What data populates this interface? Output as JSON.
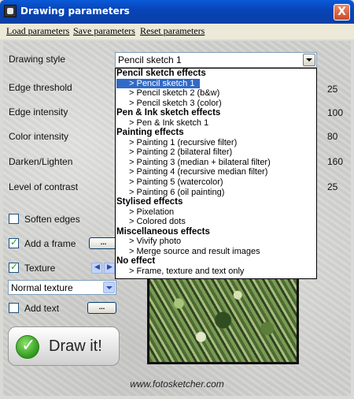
{
  "window": {
    "title": "Drawing parameters",
    "close_label": "X"
  },
  "menu": [
    "Load parameters",
    "Save parameters",
    "Reset parameters"
  ],
  "drawing_style": {
    "label": "Drawing style",
    "selected": "Pencil sketch 1",
    "options": [
      {
        "type": "group",
        "label": "Pencil sketch effects"
      },
      {
        "type": "option",
        "label": "> Pencil sketch 1",
        "selected": true
      },
      {
        "type": "option",
        "label": "> Pencil sketch 2 (b&w)"
      },
      {
        "type": "option",
        "label": "> Pencil sketch 3 (color)"
      },
      {
        "type": "group",
        "label": "Pen & Ink sketch effects"
      },
      {
        "type": "option",
        "label": "> Pen & Ink sketch 1"
      },
      {
        "type": "group",
        "label": "Painting effects"
      },
      {
        "type": "option",
        "label": "> Painting 1 (recursive filter)"
      },
      {
        "type": "option",
        "label": "> Painting 2 (bilateral filter)"
      },
      {
        "type": "option",
        "label": "> Painting 3 (median + bilateral filter)"
      },
      {
        "type": "option",
        "label": "> Painting 4 (recursive median filter)"
      },
      {
        "type": "option",
        "label": "> Painting 5 (watercolor)"
      },
      {
        "type": "option",
        "label": "> Painting 6 (oil painting)"
      },
      {
        "type": "group",
        "label": "Stylised effects"
      },
      {
        "type": "option",
        "label": "> Pixelation"
      },
      {
        "type": "option",
        "label": "> Colored dots"
      },
      {
        "type": "group",
        "label": "Miscellaneous effects"
      },
      {
        "type": "option",
        "label": "> Vivify photo"
      },
      {
        "type": "option",
        "label": "> Merge source and result images"
      },
      {
        "type": "group",
        "label": "No effect"
      },
      {
        "type": "option",
        "label": "> Frame, texture and text only"
      }
    ]
  },
  "params": [
    {
      "label": "Edge threshold",
      "value": "25"
    },
    {
      "label": "Edge intensity",
      "value": "100"
    },
    {
      "label": "Color intensity",
      "value": "80"
    },
    {
      "label": "Darken/Lighten",
      "value": "160"
    },
    {
      "label": "Level of contrast",
      "value": "25"
    }
  ],
  "options": {
    "soften_edges": {
      "label": "Soften edges",
      "checked": false
    },
    "add_frame": {
      "label": "Add a frame",
      "checked": true,
      "button": "..."
    },
    "texture": {
      "label": "Texture",
      "checked": true,
      "select": "Normal texture"
    },
    "add_text": {
      "label": "Add text",
      "checked": false,
      "button": "..."
    }
  },
  "draw_button": "Draw it!",
  "footer": "www.fotosketcher.com",
  "colors": {
    "titlebar": "#0845b8",
    "selection": "#316ac5",
    "draw_icon": "#2c9a1a"
  }
}
